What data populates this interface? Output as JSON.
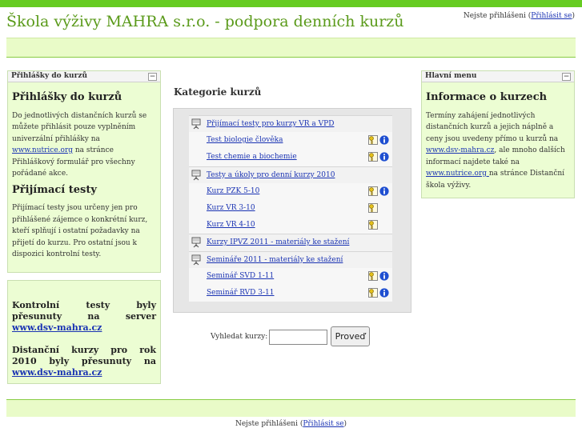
{
  "header": {
    "site_title": "Škola výživy MAHRA s.r.o. - podpora denních kurzů",
    "login_text": "Nejste přihlášeni (",
    "login_link": "Přihlásit se",
    "login_close": ")"
  },
  "left_block": {
    "header": "Přihlášky do kurzů",
    "hide_symbol": "−",
    "title1": "Přihlášky do kurzů",
    "p1_part1": "Do jednotlivých distančních kurzů se můžete přihlásit pouze vyplněním univerzální přihlášky na ",
    "p1_link": "www.nutrice.org",
    "p1_part2": " na stránce Přihláškový formulář pro všechny pořádané akce.",
    "title2": "Přijímací testy",
    "p2": "Přijímací testy jsou určeny jen pro přihlášené zájemce o konkrétní kurz, kteří splňují i ostatní požadavky na přijetí do kurzu. Pro ostatní jsou k dispozici kontrolní testy."
  },
  "notice_block": {
    "n1_text": "Kontrolní testy byly přesunuty na server ",
    "n1_link": "www.dsv-mahra.cz",
    "n2_text": "Distanční kurzy pro rok 2010 byly přesunuty na ",
    "n2_link": "www.dsv-mahra.cz"
  },
  "right_block": {
    "header": "Hlavní menu",
    "hide_symbol": "−",
    "title": "Informace o kurzech",
    "p_part1": "Termíny zahájení jednotlivých distančních kurzů a jejich náplně a ceny jsou uvedeny přímo u kurzů na ",
    "p_link1": "www.dsv-mahra.cz",
    "p_part2": ", ale mnoho dalších informací najdete také na ",
    "p_link2": "www.nutrice.org ",
    "p_part3": "na stránce Distanční škola výživy."
  },
  "main": {
    "title": "Kategorie kurzů",
    "rows": [
      {
        "type": "category",
        "label": "Přijímací testy pro kurzy VR a VPD"
      },
      {
        "type": "course",
        "label": "Test biologie člověka",
        "key": true,
        "info": true
      },
      {
        "type": "course",
        "label": "Test chemie a biochemie",
        "key": true,
        "info": true
      },
      {
        "type": "category",
        "label": "Testy a úkoly pro denní kurzy 2010"
      },
      {
        "type": "course",
        "label": "Kurz PZK 5-10",
        "key": true,
        "info": true
      },
      {
        "type": "course",
        "label": "Kurz VR 3-10",
        "key": true,
        "info": false
      },
      {
        "type": "course",
        "label": "Kurz VR 4-10",
        "key": true,
        "info": false
      },
      {
        "type": "category",
        "label": "Kurzy IPVZ 2011 - materiály ke stažení"
      },
      {
        "type": "category",
        "label": "Semináře 2011 - materiály ke stažení"
      },
      {
        "type": "course",
        "label": "Seminář SVD 1-11",
        "key": true,
        "info": true
      },
      {
        "type": "course",
        "label": "Seminář RVD 3-11",
        "key": true,
        "info": true
      }
    ],
    "search_label": "Vyhledat kurzy:",
    "search_value": "",
    "search_button": "Proveď"
  },
  "footer": {
    "login_text": "Nejste přihlášeni (",
    "login_link": "Přihlásit se",
    "login_close": ")"
  },
  "colors": {
    "brand_green": "#66cc22",
    "title_green": "#5a9a1a",
    "block_bg": "#ecfdd3",
    "link_blue": "#1a33b3"
  }
}
